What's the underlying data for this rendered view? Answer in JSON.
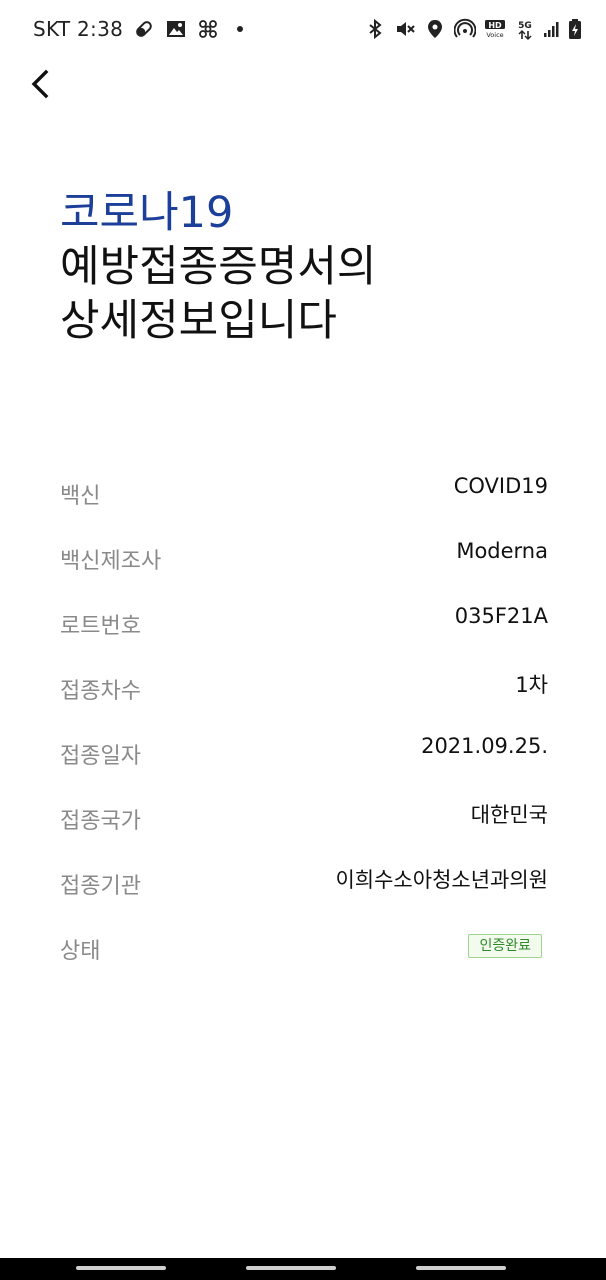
{
  "status_bar": {
    "carrier_time": "SKT 2:38",
    "left_icons": [
      "pill-icon",
      "image-icon",
      "fan-icon",
      "dot-icon"
    ],
    "right_icons": [
      "bluetooth-icon",
      "mute-icon",
      "location-icon",
      "hotspot-icon",
      "hd-voice-icon",
      "5g-icon",
      "signal-icon",
      "battery-icon"
    ],
    "hd_text": "HD",
    "voice_text": "Voice",
    "network_text": "5G"
  },
  "header": {
    "title_accent": "코로나19",
    "title_line1": "예방접종증명서의",
    "title_line2": "상세정보입니다"
  },
  "details": [
    {
      "label": "백신",
      "value": "COVID19"
    },
    {
      "label": "백신제조사",
      "value": "Moderna"
    },
    {
      "label": "로트번호",
      "value": "035F21A"
    },
    {
      "label": "접종차수",
      "value": "1차"
    },
    {
      "label": "접종일자",
      "value": "2021.09.25."
    },
    {
      "label": "접종국가",
      "value": "대한민국"
    },
    {
      "label": "접종기관",
      "value": "이희수소아청소년과의원"
    },
    {
      "label": "상태",
      "badge": "인증완료"
    }
  ],
  "colors": {
    "accent_blue": "#1c3f9a",
    "label_gray": "#8a8a8a",
    "badge_green": "#2f8a2a",
    "badge_border": "#9fd58f"
  }
}
